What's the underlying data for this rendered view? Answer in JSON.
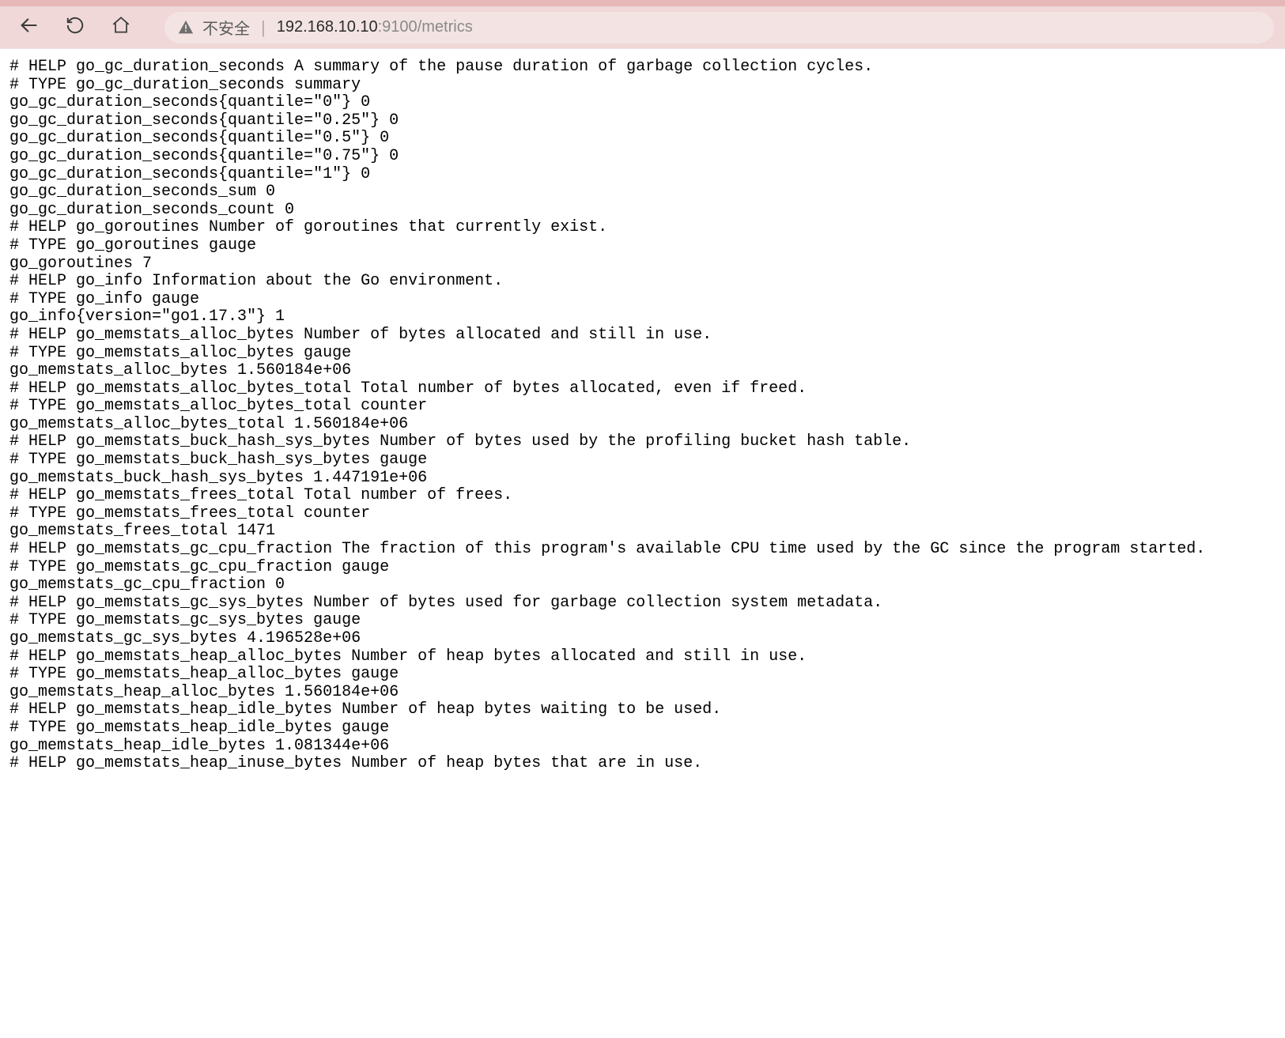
{
  "toolbar": {
    "insecure_label": "不安全",
    "url_host": "192.168.10.10",
    "url_port": ":9100",
    "url_path": "/metrics"
  },
  "metrics_lines": [
    "# HELP go_gc_duration_seconds A summary of the pause duration of garbage collection cycles.",
    "# TYPE go_gc_duration_seconds summary",
    "go_gc_duration_seconds{quantile=\"0\"} 0",
    "go_gc_duration_seconds{quantile=\"0.25\"} 0",
    "go_gc_duration_seconds{quantile=\"0.5\"} 0",
    "go_gc_duration_seconds{quantile=\"0.75\"} 0",
    "go_gc_duration_seconds{quantile=\"1\"} 0",
    "go_gc_duration_seconds_sum 0",
    "go_gc_duration_seconds_count 0",
    "# HELP go_goroutines Number of goroutines that currently exist.",
    "# TYPE go_goroutines gauge",
    "go_goroutines 7",
    "# HELP go_info Information about the Go environment.",
    "# TYPE go_info gauge",
    "go_info{version=\"go1.17.3\"} 1",
    "# HELP go_memstats_alloc_bytes Number of bytes allocated and still in use.",
    "# TYPE go_memstats_alloc_bytes gauge",
    "go_memstats_alloc_bytes 1.560184e+06",
    "# HELP go_memstats_alloc_bytes_total Total number of bytes allocated, even if freed.",
    "# TYPE go_memstats_alloc_bytes_total counter",
    "go_memstats_alloc_bytes_total 1.560184e+06",
    "# HELP go_memstats_buck_hash_sys_bytes Number of bytes used by the profiling bucket hash table.",
    "# TYPE go_memstats_buck_hash_sys_bytes gauge",
    "go_memstats_buck_hash_sys_bytes 1.447191e+06",
    "# HELP go_memstats_frees_total Total number of frees.",
    "# TYPE go_memstats_frees_total counter",
    "go_memstats_frees_total 1471",
    "# HELP go_memstats_gc_cpu_fraction The fraction of this program's available CPU time used by the GC since the program started.",
    "# TYPE go_memstats_gc_cpu_fraction gauge",
    "go_memstats_gc_cpu_fraction 0",
    "# HELP go_memstats_gc_sys_bytes Number of bytes used for garbage collection system metadata.",
    "# TYPE go_memstats_gc_sys_bytes gauge",
    "go_memstats_gc_sys_bytes 4.196528e+06",
    "# HELP go_memstats_heap_alloc_bytes Number of heap bytes allocated and still in use.",
    "# TYPE go_memstats_heap_alloc_bytes gauge",
    "go_memstats_heap_alloc_bytes 1.560184e+06",
    "# HELP go_memstats_heap_idle_bytes Number of heap bytes waiting to be used.",
    "# TYPE go_memstats_heap_idle_bytes gauge",
    "go_memstats_heap_idle_bytes 1.081344e+06",
    "# HELP go_memstats_heap_inuse_bytes Number of heap bytes that are in use."
  ]
}
